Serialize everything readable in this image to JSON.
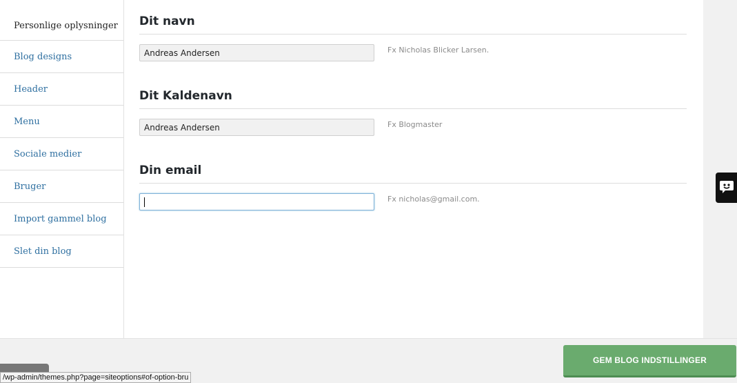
{
  "sidebar": {
    "items": [
      {
        "label": "Personlige oplysninger"
      },
      {
        "label": "Blog designs"
      },
      {
        "label": "Header"
      },
      {
        "label": "Menu"
      },
      {
        "label": "Sociale medier"
      },
      {
        "label": "Bruger"
      },
      {
        "label": "Import gammel blog"
      },
      {
        "label": "Slet din blog"
      }
    ]
  },
  "form": {
    "name": {
      "title": "Dit navn",
      "value": "Andreas Andersen",
      "hint": "Fx Nicholas Blicker Larsen."
    },
    "nickname": {
      "title": "Dit Kaldenavn",
      "value": "Andreas Andersen",
      "hint": "Fx Blogmaster"
    },
    "email": {
      "title": "Din email",
      "value": "",
      "hint": "Fx nicholas@gmail.com."
    }
  },
  "footer": {
    "save_label": "GEM BLOG INDSTILLINGER"
  },
  "status_bar": {
    "url": "/wp-admin/themes.php?page=siteoptions#of-option-bru"
  },
  "icons": {
    "chat": "chat-bubble-icon"
  },
  "colors": {
    "link": "#2e6fa0",
    "save_button": "#6aab6e",
    "hint": "#8a8a8a"
  }
}
